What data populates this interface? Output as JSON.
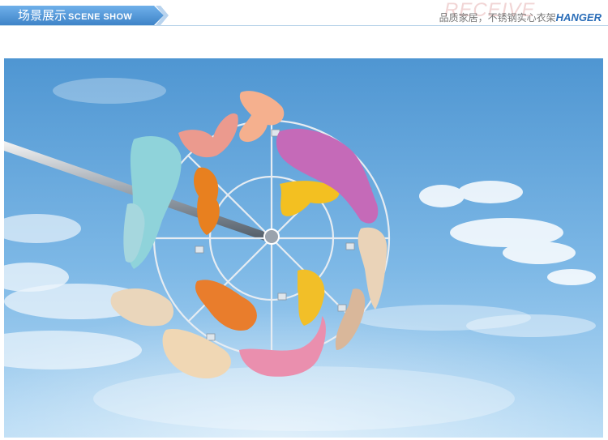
{
  "header": {
    "section_title_zh": "场景展示",
    "section_title_en": "SCENE SHOW",
    "watermark_text": "RECEIVE",
    "slogan_zh": "品质家居，不锈钢实心衣架",
    "slogan_en": "HANGER"
  },
  "scene": {
    "description_icon": "hanger-photo-icon"
  },
  "colors": {
    "tab_blue": "#4f95d6",
    "tab_light": "#b8d3ee",
    "sky_top": "#5b9fd6",
    "sky_bottom": "#a8cff0",
    "slogan_blue": "#2a6db8"
  }
}
